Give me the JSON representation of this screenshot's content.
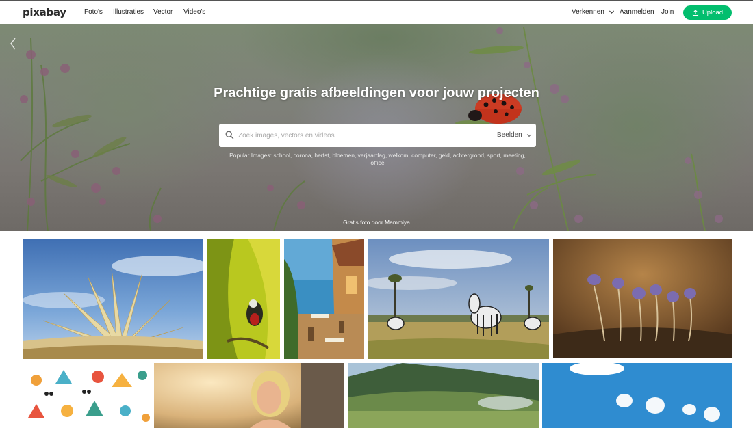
{
  "nav": {
    "logo": "pixabay",
    "links": [
      "Foto's",
      "Illustraties",
      "Vector",
      "Video's"
    ],
    "explore": "Verkennen",
    "login": "Aanmelden",
    "join": "Join",
    "upload": "Upload"
  },
  "hero": {
    "title": "Prachtige gratis afbeeldingen voor jouw projecten",
    "search_placeholder": "Zoek images, vectors en videos",
    "search_type": "Beelden",
    "popular": "Popular Images: school, corona, herfst, bloemen, verjaardag, welkom, computer, geld, achtergrond, sport, meeting, office",
    "credit": "Gratis foto door Mammiya"
  },
  "colors": {
    "brand_green": "#02be6e"
  },
  "icons": {
    "search": "search-icon",
    "chevron": "chevron-down-icon",
    "upload": "upload-icon"
  }
}
